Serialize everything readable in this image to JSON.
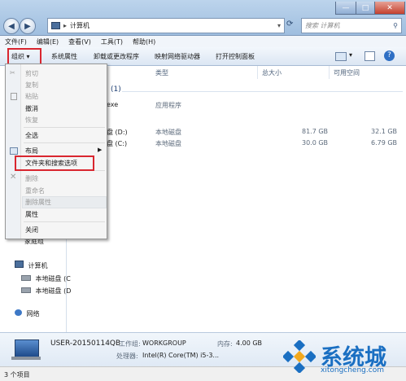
{
  "window": {
    "address_crumb": "计算机",
    "search_placeholder": "搜索 计算机",
    "minimize": "—",
    "maximize": "□",
    "close": "✕"
  },
  "menubar": [
    "文件(F)",
    "编辑(E)",
    "查看(V)",
    "工具(T)",
    "帮助(H)"
  ],
  "toolbar": {
    "organize": "组织",
    "items": [
      "系统属性",
      "卸载或更改程序",
      "映射网络驱动器",
      "打开控制面板"
    ]
  },
  "columns": {
    "type": "类型",
    "total": "总大小",
    "free": "可用空间"
  },
  "content": {
    "group1_header": "(1)",
    "program_name": "exe",
    "program_type": "应用程序",
    "drive_d_label": "盘 (D:)",
    "drive_d_type": "本地磁盘",
    "drive_d_total": "81.7 GB",
    "drive_d_free": "32.1 GB",
    "drive_c_label": "盘 (C:)",
    "drive_c_type": "本地磁盘",
    "drive_c_total": "30.0 GB",
    "drive_c_free": "6.79 GB"
  },
  "organize_menu": {
    "cut": "剪切",
    "copy": "复制",
    "paste": "粘贴",
    "undo": "撤消",
    "redo": "恢复",
    "select_all": "全选",
    "layout": "布局",
    "folder_options": "文件夹和搜索选项",
    "delete": "删除",
    "rename": "重命名",
    "remove_properties": "删除属性",
    "properties": "属性",
    "close": "关闭"
  },
  "navpane": {
    "partial_item": "家庭组",
    "computer": "计算机",
    "disk1": "本地磁盘 (C",
    "disk2": "本地磁盘 (D",
    "network": "网络"
  },
  "details": {
    "computer_name": "USER-20150114QB",
    "workgroup_label": "工作组:",
    "workgroup": "WORKGROUP",
    "memory_label": "内存:",
    "memory": "4.00 GB",
    "cpu_label": "处理器:",
    "cpu": "Intel(R) Core(TM) i5-3..."
  },
  "status": {
    "items": "3 个项目"
  },
  "watermark": {
    "brand": "系统城",
    "domain": "xitongcheng.com"
  },
  "colors": {
    "highlight": "#d9262f",
    "brand_blue": "#1a6fc2"
  }
}
